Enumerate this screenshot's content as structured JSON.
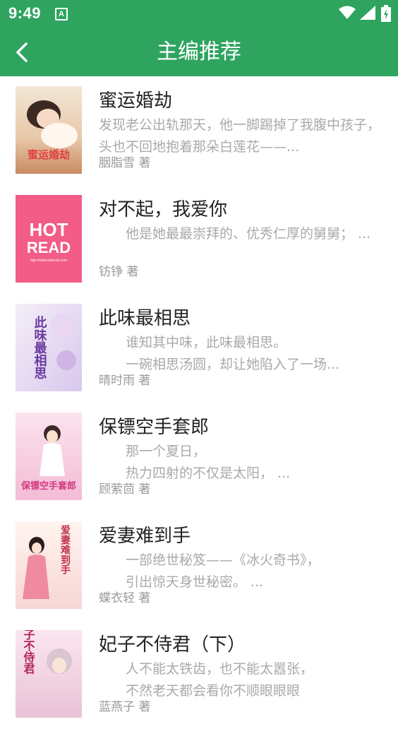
{
  "status_bar": {
    "time": "9:49",
    "notification_icon": "A"
  },
  "app_bar": {
    "title": "主编推荐"
  },
  "colors": {
    "brand_green": "#2fa45f"
  },
  "books": [
    {
      "title": "蜜运婚劫",
      "desc": "发现老公出轨那天，他一脚踢掉了我腹中孩子，头也不回地抱着那朵白莲花——...",
      "author": "胭脂雪 著",
      "cover_text": "蜜运婚劫"
    },
    {
      "title": "对不起，我爱你",
      "desc": "　　他是她最最崇拜的、优秀仁厚的舅舅； ...",
      "author": "钫铮 著",
      "cover_text_1": "HOT",
      "cover_text_2": "READ",
      "cover_text_3": "http://www.hotread.com"
    },
    {
      "title": "此味最相思",
      "desc": "　　谁知其中味，此味最相思。\n　　一碗相思汤圆，却让她陷入了一场...",
      "author": "晴时雨 著",
      "cover_text": "此味最相思"
    },
    {
      "title": "保镖空手套郎",
      "desc": "　　那一个夏日，\n　　热力四射的不仅是太阳， ...",
      "author": "顾萦茴 著",
      "cover_text": "保镖空手套郎"
    },
    {
      "title": "爱妻难到手",
      "desc": "　　一部绝世秘笈——《冰火奇书》，\n　　引出惊天身世秘密。 ...",
      "author": "蝶衣轻 著",
      "cover_text": "爱妻难到手"
    },
    {
      "title": "妃子不侍君（下）",
      "desc": "　　人不能太铁齿，也不能太嚣张，\n　　不然老天都会看你不顺眼眼眼",
      "author": "蓝燕子 著",
      "cover_text": "妃子不侍君"
    }
  ]
}
